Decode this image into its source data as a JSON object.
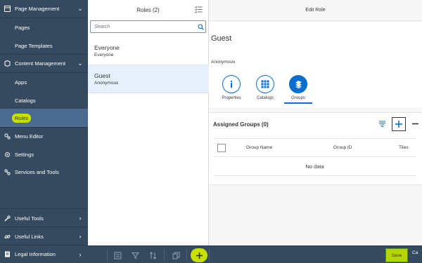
{
  "sidebar": {
    "items": [
      {
        "label": "Page Management",
        "icon": "page-management-icon",
        "expanded": true
      },
      {
        "label": "Pages"
      },
      {
        "label": "Page Templates"
      },
      {
        "label": "Content Management",
        "icon": "content-management-icon",
        "expanded": true
      },
      {
        "label": "Apps"
      },
      {
        "label": "Catalogs"
      },
      {
        "label": "Roles",
        "active": true
      },
      {
        "label": "Menu Editor",
        "icon": "menu-editor-icon"
      },
      {
        "label": "Settings",
        "icon": "gear-icon"
      },
      {
        "label": "Services and Tools",
        "icon": "services-icon"
      },
      {
        "label": "Useful Tools",
        "icon": "wrench-icon"
      },
      {
        "label": "Useful Links",
        "icon": "link-icon"
      },
      {
        "label": "Legal Information",
        "icon": "legal-icon"
      }
    ]
  },
  "master": {
    "title": "Roles (2)",
    "search_placeholder": "Search",
    "items": [
      {
        "title": "Everyone",
        "description": "Everyone"
      },
      {
        "title": "Guest",
        "description": "Anonymous",
        "selected": true
      }
    ]
  },
  "detail": {
    "header": "Edit Role",
    "title": "Guest",
    "subtitle": "Anonymous",
    "tabs": [
      {
        "label": "Properties",
        "icon": "info-icon"
      },
      {
        "label": "Catalogs",
        "icon": "grid-icon"
      },
      {
        "label": "Groups",
        "icon": "groups-icon",
        "active": true
      }
    ],
    "groups": {
      "title": "Assigned Groups (0)",
      "columns": [
        "Group Name",
        "Group ID",
        "Tiles"
      ],
      "empty_text": "No data"
    }
  },
  "footer": {
    "save_label": "Save",
    "cancel_label": "Ca"
  },
  "colors": {
    "shell": "#354a5f",
    "accent": "#0a6ed1",
    "highlight": "#c8e000",
    "selected_row": "#e5f0fa"
  }
}
